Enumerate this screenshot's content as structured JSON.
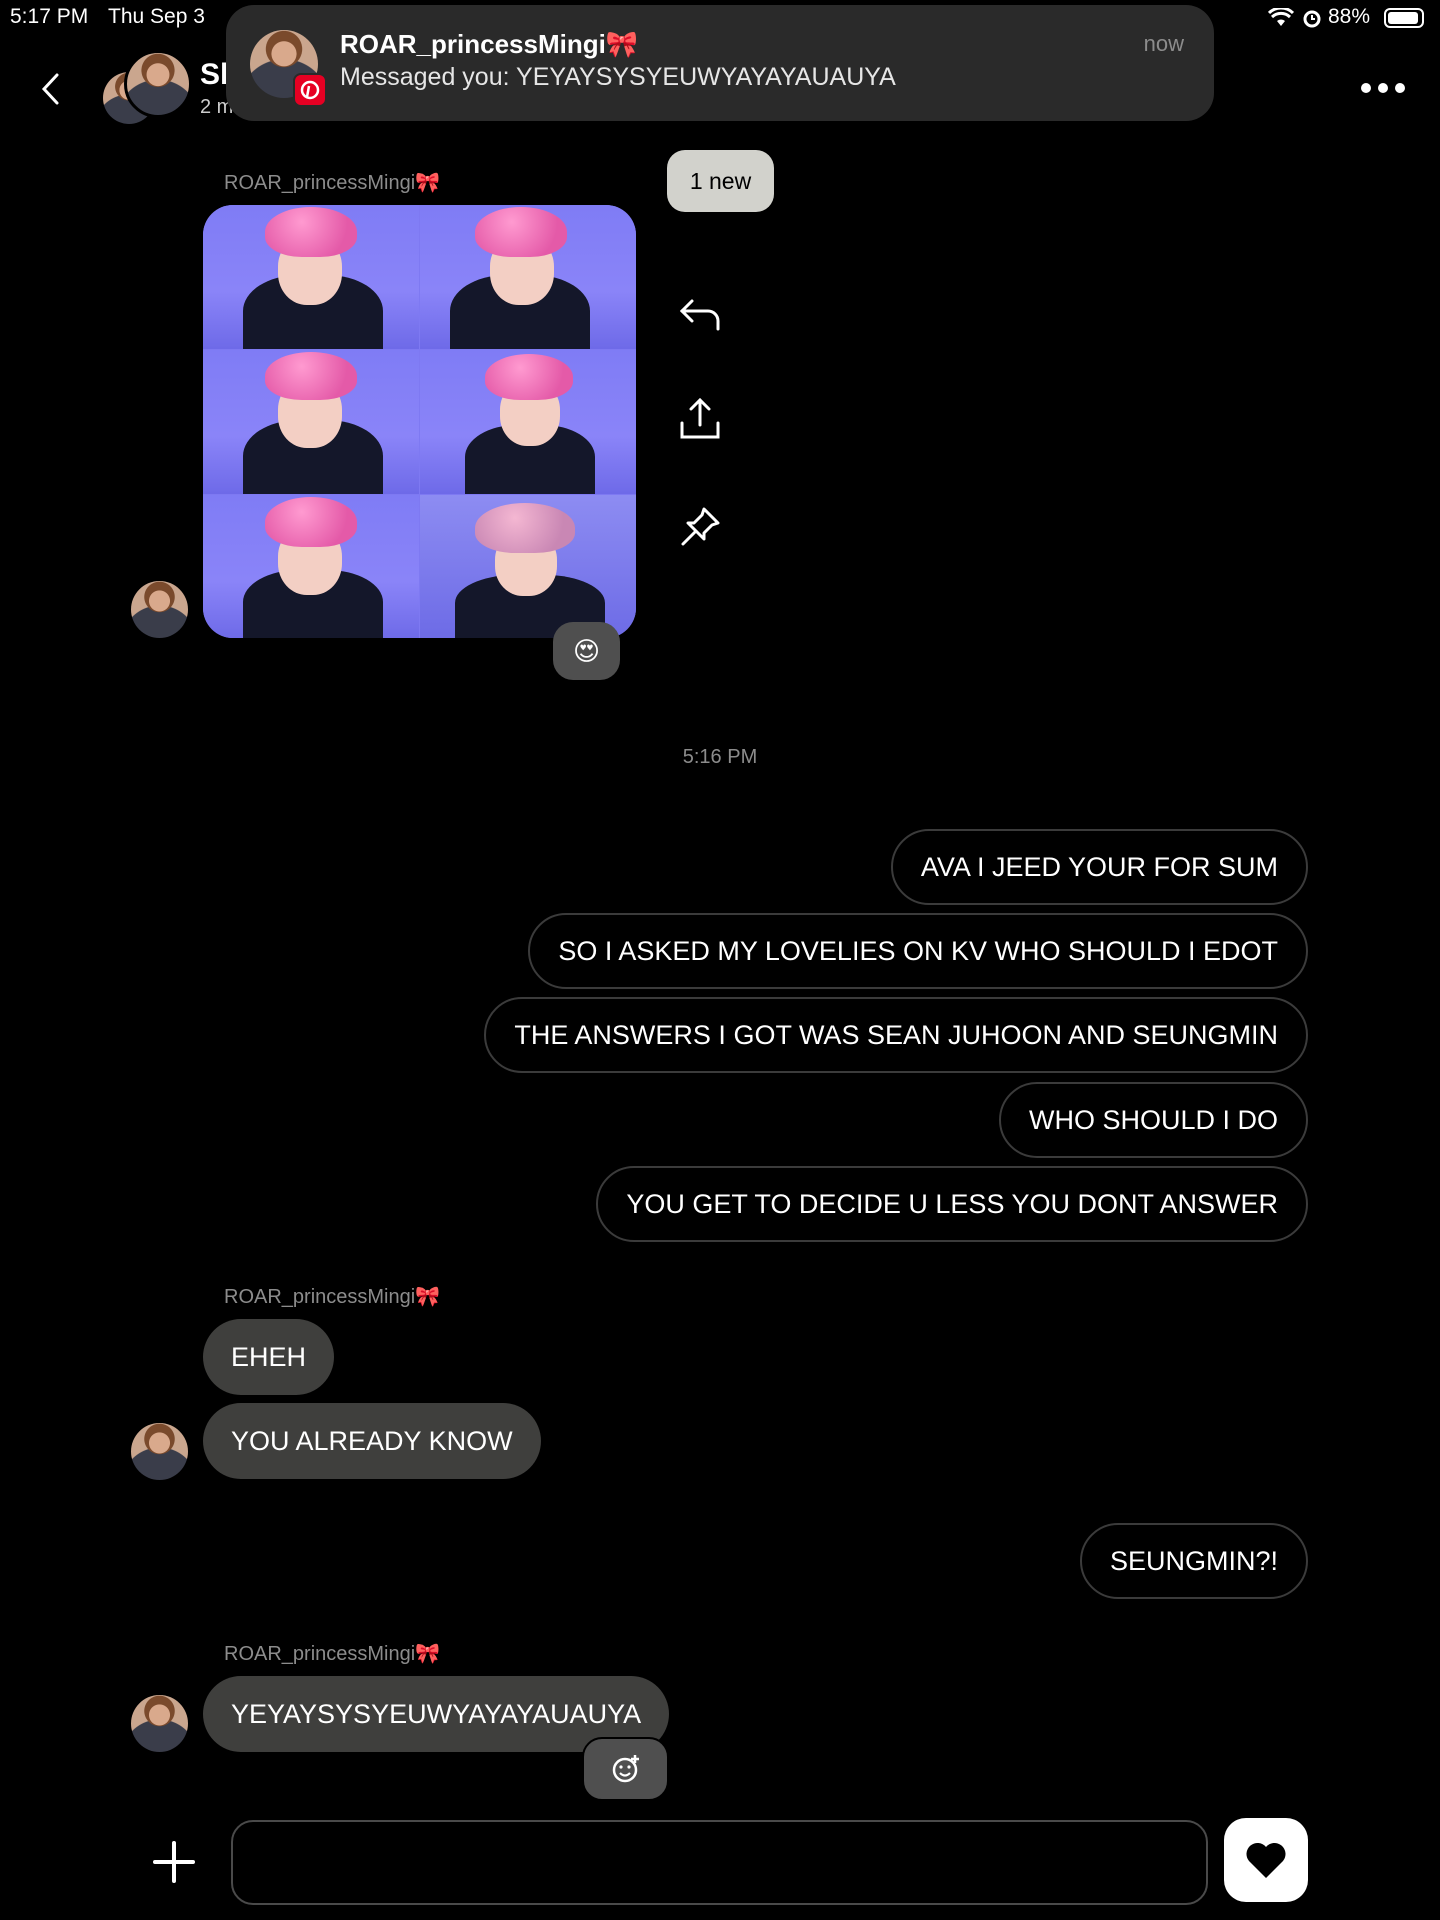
{
  "status_bar": {
    "time": "5:17 PM",
    "date": "Thu Sep 3",
    "battery": "88%"
  },
  "header": {
    "name_partial": "Sh",
    "subtitle_partial": "2 m"
  },
  "notification": {
    "title": "ROAR_princessMingi🎀",
    "body": "Messaged you: YEYAYSYSYEUWYAYAYAUAUYA",
    "time": "now",
    "app_icon": "pinterest-icon"
  },
  "new_badge": "1 new",
  "messages_top": {
    "sender": "ROAR_princessMingi🎀",
    "reaction": "😍"
  },
  "timestamp": "5:16 PM",
  "outgoing_1": [
    "AVA I JEED YOUR FOR SUM",
    "SO I ASKED MY LOVELIES ON KV WHO SHOULD I EDOT",
    "THE ANSWERS I GOT WAS SEAN JUHOON AND SEUNGMIN",
    "WHO SHOULD I DO",
    "YOU GET TO DECIDE U LESS YOU DONT ANSWER"
  ],
  "incoming_1": {
    "sender": "ROAR_princessMingi🎀",
    "messages": [
      "EHEH",
      "YOU ALREADY KNOW"
    ]
  },
  "outgoing_2": "SEUNGMIN?!",
  "incoming_2": {
    "sender": "ROAR_princessMingi🎀",
    "message": "YEYAYSYSYEUWYAYAYAUAUYA"
  },
  "composer": {
    "placeholder": ""
  },
  "colors": {
    "background": "#000000",
    "incoming_bubble": "#3f3f3d",
    "outgoing_border": "#3b3b3b",
    "notification_bg": "#2a2a2a",
    "badge_bg": "#d2d2cc"
  }
}
